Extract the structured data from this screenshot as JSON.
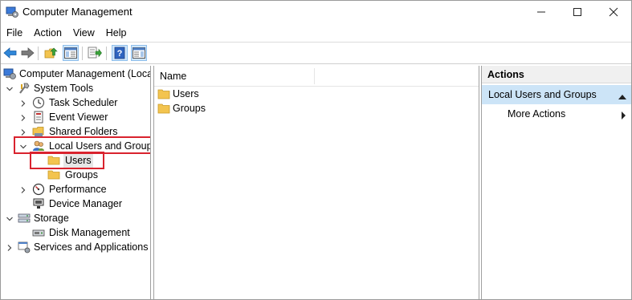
{
  "window": {
    "title": "Computer Management"
  },
  "menu": {
    "items": [
      "File",
      "Action",
      "View",
      "Help"
    ]
  },
  "toolbar": {
    "buttons": [
      "back-arrow-icon",
      "forward-arrow-icon",
      "up-folder-icon",
      "show-hide-tree-icon",
      "export-list-icon",
      "help-icon",
      "show-hide-action-pane-icon"
    ]
  },
  "tree": {
    "root": "Computer Management (Local",
    "system_tools": "System Tools",
    "task_scheduler": "Task Scheduler",
    "event_viewer": "Event Viewer",
    "shared_folders": "Shared Folders",
    "local_users_groups": "Local Users and Groups",
    "users": "Users",
    "groups": "Groups",
    "performance": "Performance",
    "device_manager": "Device Manager",
    "storage": "Storage",
    "disk_management": "Disk Management",
    "services_apps": "Services and Applications"
  },
  "content": {
    "column_name": "Name",
    "items": [
      "Users",
      "Groups"
    ]
  },
  "actions": {
    "header": "Actions",
    "group": "Local Users and Groups",
    "item": "More Actions"
  },
  "colors": {
    "highlight_box": "#d9232e",
    "folder": "#f3c44f",
    "actions_selected_bg": "#cce4f7",
    "accent_blue": "#1f6fc5"
  }
}
